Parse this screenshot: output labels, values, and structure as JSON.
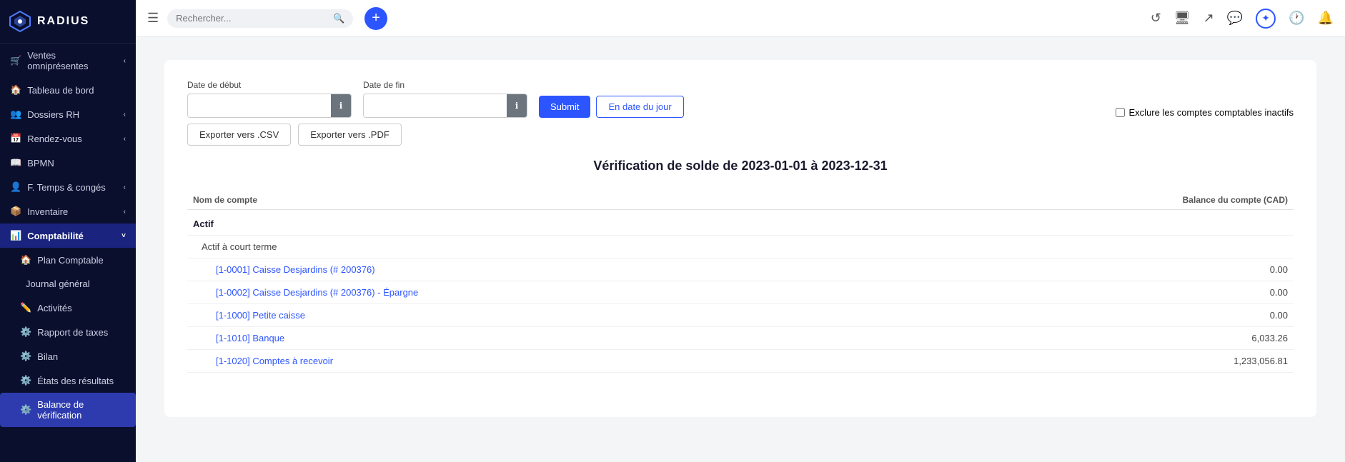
{
  "app": {
    "name": "RADIUS"
  },
  "sidebar": {
    "items": [
      {
        "id": "ventes",
        "label": "Ventes omniprésentes",
        "icon": "🛒",
        "hasChevron": true,
        "indent": 0
      },
      {
        "id": "tableau",
        "label": "Tableau de bord",
        "icon": "🏠",
        "hasChevron": false,
        "indent": 0
      },
      {
        "id": "dossiers",
        "label": "Dossiers RH",
        "icon": "👥",
        "hasChevron": true,
        "indent": 0
      },
      {
        "id": "rendez-vous",
        "label": "Rendez-vous",
        "icon": "",
        "hasChevron": true,
        "indent": 0
      },
      {
        "id": "bpmn",
        "label": "BPMN",
        "icon": "📖",
        "hasChevron": false,
        "indent": 0
      },
      {
        "id": "temps",
        "label": "F. Temps & congés",
        "icon": "👤",
        "hasChevron": true,
        "indent": 0
      },
      {
        "id": "inventaire",
        "label": "Inventaire",
        "icon": "",
        "hasChevron": true,
        "indent": 0
      },
      {
        "id": "comptabilite",
        "label": "Comptabilité",
        "icon": "📊",
        "hasChevron": true,
        "indent": 0,
        "active": true
      },
      {
        "id": "plan-comptable",
        "label": "Plan Comptable",
        "icon": "🏠",
        "hasChevron": false,
        "indent": 1
      },
      {
        "id": "journal-general",
        "label": "Journal général",
        "icon": "",
        "hasChevron": false,
        "indent": 1
      },
      {
        "id": "activites",
        "label": "Activités",
        "icon": "✏️",
        "hasChevron": false,
        "indent": 1
      },
      {
        "id": "rapport-taxes",
        "label": "Rapport de taxes",
        "icon": "⚙️",
        "hasChevron": false,
        "indent": 1
      },
      {
        "id": "bilan",
        "label": "Bilan",
        "icon": "⚙️",
        "hasChevron": false,
        "indent": 1
      },
      {
        "id": "etats-resultats",
        "label": "États des résultats",
        "icon": "⚙️",
        "hasChevron": false,
        "indent": 1
      },
      {
        "id": "balance-verification",
        "label": "Balance de vérification",
        "icon": "⚙️",
        "hasChevron": false,
        "indent": 1,
        "activeItem": true
      }
    ]
  },
  "topbar": {
    "search_placeholder": "Rechercher...",
    "icons": [
      "history",
      "monitor",
      "share",
      "message",
      "compass",
      "clock",
      "bell"
    ]
  },
  "form": {
    "date_debut_label": "Date de début",
    "date_fin_label": "Date de fin",
    "submit_label": "Submit",
    "en_date_label": "En date du jour",
    "export_csv_label": "Exporter vers .CSV",
    "export_pdf_label": "Exporter vers .PDF",
    "exclude_label": "Exclure les comptes comptables inactifs"
  },
  "report": {
    "title": "Vérification de solde de 2023-01-01 à 2023-12-31",
    "col_account": "Nom de compte",
    "col_balance": "Balance du compte (CAD)",
    "sections": [
      {
        "name": "Actif",
        "subsections": [
          {
            "name": "Actif à court terme",
            "accounts": [
              {
                "code": "[1-0001]",
                "name": "Caisse Desjardins (# 200376)",
                "balance": "0.00"
              },
              {
                "code": "[1-0002]",
                "name": "Caisse Desjardins (# 200376) - Épargne",
                "balance": "0.00"
              },
              {
                "code": "[1-1000]",
                "name": "Petite caisse",
                "balance": "0.00"
              },
              {
                "code": "[1-1010]",
                "name": "Banque",
                "balance": "6,033.26"
              },
              {
                "code": "[1-1020]",
                "name": "Comptes à recevoir",
                "balance": "1,233,056.81"
              }
            ]
          }
        ]
      }
    ]
  }
}
